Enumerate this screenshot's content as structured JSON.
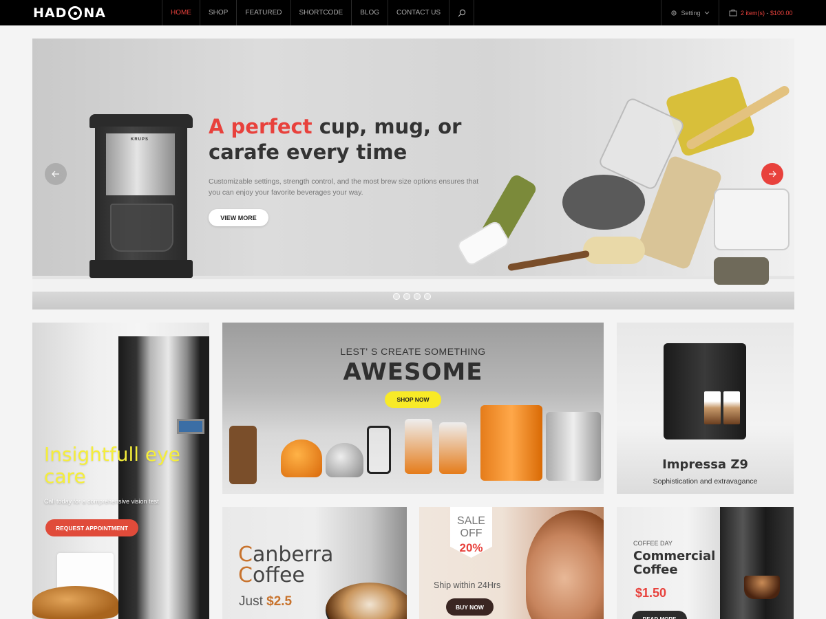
{
  "brand": {
    "logo": "HADONA",
    "logo_prefix": "HAD",
    "logo_suffix": "NA"
  },
  "nav": {
    "items": [
      {
        "label": "HOME",
        "active": true
      },
      {
        "label": "SHOP",
        "active": false
      },
      {
        "label": "FEATURED",
        "active": false
      },
      {
        "label": "SHORTCODE",
        "active": false
      },
      {
        "label": "BLOG",
        "active": false
      },
      {
        "label": "CONTACT US",
        "active": false
      }
    ],
    "search_icon": "search-icon"
  },
  "header": {
    "setting_label": "Setting",
    "cart_count": "2 item(s)",
    "cart_sep": " - ",
    "cart_total": "$100.00"
  },
  "hero": {
    "title_highlight": "A perfect",
    "title_rest": " cup, mug, or carafe every time",
    "description": "Customizable settings, strength control, and the most brew size options ensures that you can enjoy your favorite beverages your way.",
    "button": "VIEW MORE",
    "product_brand": "KRUPS",
    "slide_count": 4,
    "active_slide": 1
  },
  "banners": {
    "eyecare": {
      "title": "Insightfull eye care",
      "subtitle": "Call today for a comprehensive vision test",
      "button": "REQUEST APPOINTMENT"
    },
    "awesome": {
      "kicker": "LEST' S CREATE SOMETHING",
      "title": "AWESOME",
      "button": "SHOP NOW"
    },
    "impressa": {
      "title": "Impressa Z9",
      "subtitle": "Sophistication and extravagance"
    },
    "canberra": {
      "line1_cap": "C",
      "line1_rest": "anberra",
      "line2_cap": "C",
      "line2_rest": "offee",
      "price_label": "Just",
      "price": "$2.5"
    },
    "sale": {
      "sale": "SALE",
      "off": "OFF",
      "percent": "20%",
      "ship": "Ship within 24Hrs",
      "button": "BUY NOW"
    },
    "commercial": {
      "kicker": "COFFEE DAY",
      "title": "Commercial Coffee",
      "price": "$1.50",
      "button": "READ MORE"
    }
  },
  "colors": {
    "accent": "#e8413c",
    "yellow": "#f8ea27",
    "topbar": "#000000"
  }
}
